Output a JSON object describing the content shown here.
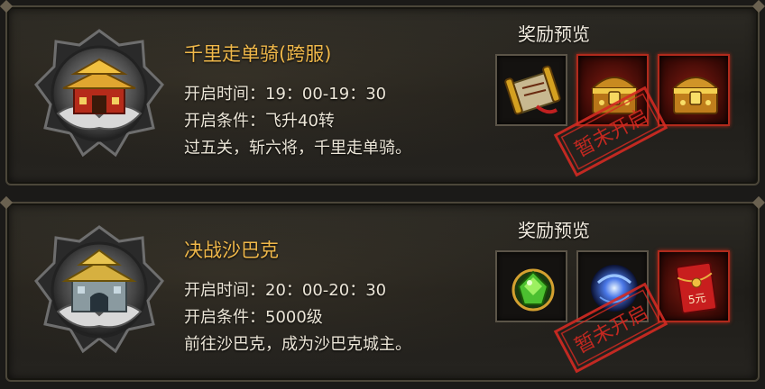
{
  "events": [
    {
      "title": "千里走单骑(跨服)",
      "open_time_label": "开启时间：",
      "open_time_value": "19：00-19：30",
      "open_cond_label": "开启条件：",
      "open_cond_value": "飞升40转",
      "description": "过五关，斩六将，千里走单骑。",
      "reward_header": "奖励预览",
      "stamp_text": "暂未开启",
      "rewards": [
        "scroll-item-icon",
        "treasure-chest-icon",
        "treasure-chest-icon"
      ]
    },
    {
      "title": "决战沙巴克",
      "open_time_label": "开启时间：",
      "open_time_value": "20：00-20：30",
      "open_cond_label": "开启条件：",
      "open_cond_value": "5000级",
      "description": "前往沙巴克，成为沙巴克城主。",
      "reward_header": "奖励预览",
      "stamp_text": "暂未开启",
      "red_packet_text": "5元",
      "rewards": [
        "green-gem-icon",
        "blue-orb-icon",
        "red-packet-icon"
      ]
    }
  ],
  "colors": {
    "title": "#f0b84a",
    "text": "#ece6d8",
    "slot_red": "#b02a1c",
    "stamp": "#d42a22"
  }
}
